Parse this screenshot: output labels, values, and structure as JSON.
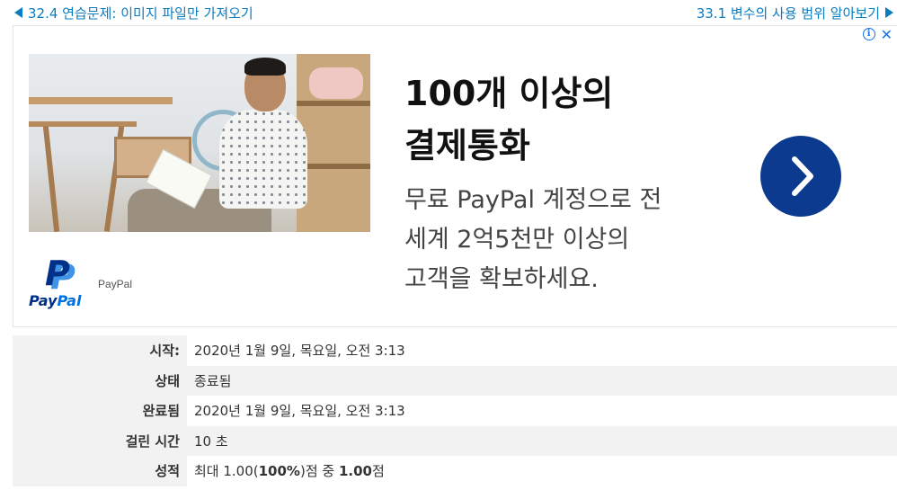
{
  "nav": {
    "prev_label": "32.4 연습문제: 이미지 파일만 가져오기",
    "next_label": "33.1 변수의 사용 범위 알아보기"
  },
  "ad": {
    "headline_line1": "100개 이상의",
    "headline_line2": "결제통화",
    "body_line1": "무료 PayPal 계정으로 전",
    "body_line2": "세계 2억5천만 이상의",
    "body_line3": "고객을 확보하세요.",
    "brand": "PayPal",
    "logo_word_pay": "Pay",
    "logo_word_pal": "Pal",
    "logo_mark": "P",
    "info_glyph": "i",
    "close_glyph": "✕",
    "colors": {
      "cta": "#0b3a8f",
      "paypal_dark": "#003087",
      "paypal_light": "#0070e0"
    }
  },
  "summary": {
    "started_label": "시작:",
    "started_value": "2020년 1월 9일, 목요일, 오전 3:13",
    "state_label": "상태",
    "state_value": "종료됨",
    "completed_label": "완료됨",
    "completed_value": "2020년 1월 9일, 목요일, 오전 3:13",
    "duration_label": "걸린 시간",
    "duration_value": "10 초",
    "grade_label": "성적",
    "grade_prefix": "최대 1.00(",
    "grade_percent": "100%",
    "grade_middle": ")점 중 ",
    "grade_score": "1.00",
    "grade_suffix": "점"
  },
  "colors": {
    "link": "#0a7cc1",
    "row_shade": "#f2f2f2"
  }
}
